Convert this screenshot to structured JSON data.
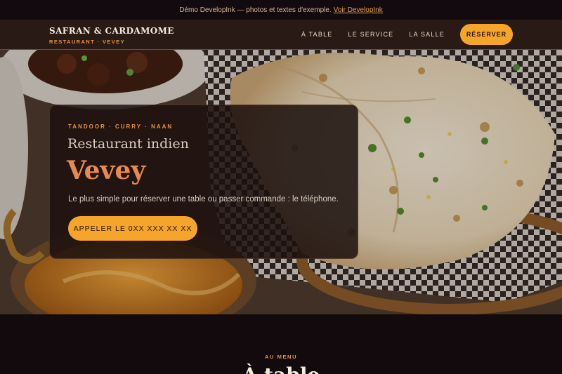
{
  "demo_bar": {
    "text": "Démo DevelopInk — photos et textes d'exemple.",
    "link_label": "Voir DevelopInk"
  },
  "header": {
    "brand_name": "SAFRAN & CARDAMOME",
    "brand_sub": "RESTAURANT · VEVEY",
    "nav": [
      "À TABLE",
      "LE SERVICE",
      "LA SALLE"
    ],
    "reserve_label": "RÉSERVER"
  },
  "hero": {
    "kicker": "TANDOOR · CURRY · NAAN",
    "title": "Restaurant indien",
    "city": "Vevey",
    "text": "Le plus simple pour réserver une table ou passer commande : le téléphone.",
    "call_label": "APPELER LE 0XX XXX XX XX"
  },
  "menu": {
    "kicker": "AU MENU",
    "title": "À table"
  },
  "colors": {
    "accent": "#f5a52b",
    "brand_orange": "#e8923a",
    "city": "#e68a52",
    "background": "#130a0d"
  }
}
